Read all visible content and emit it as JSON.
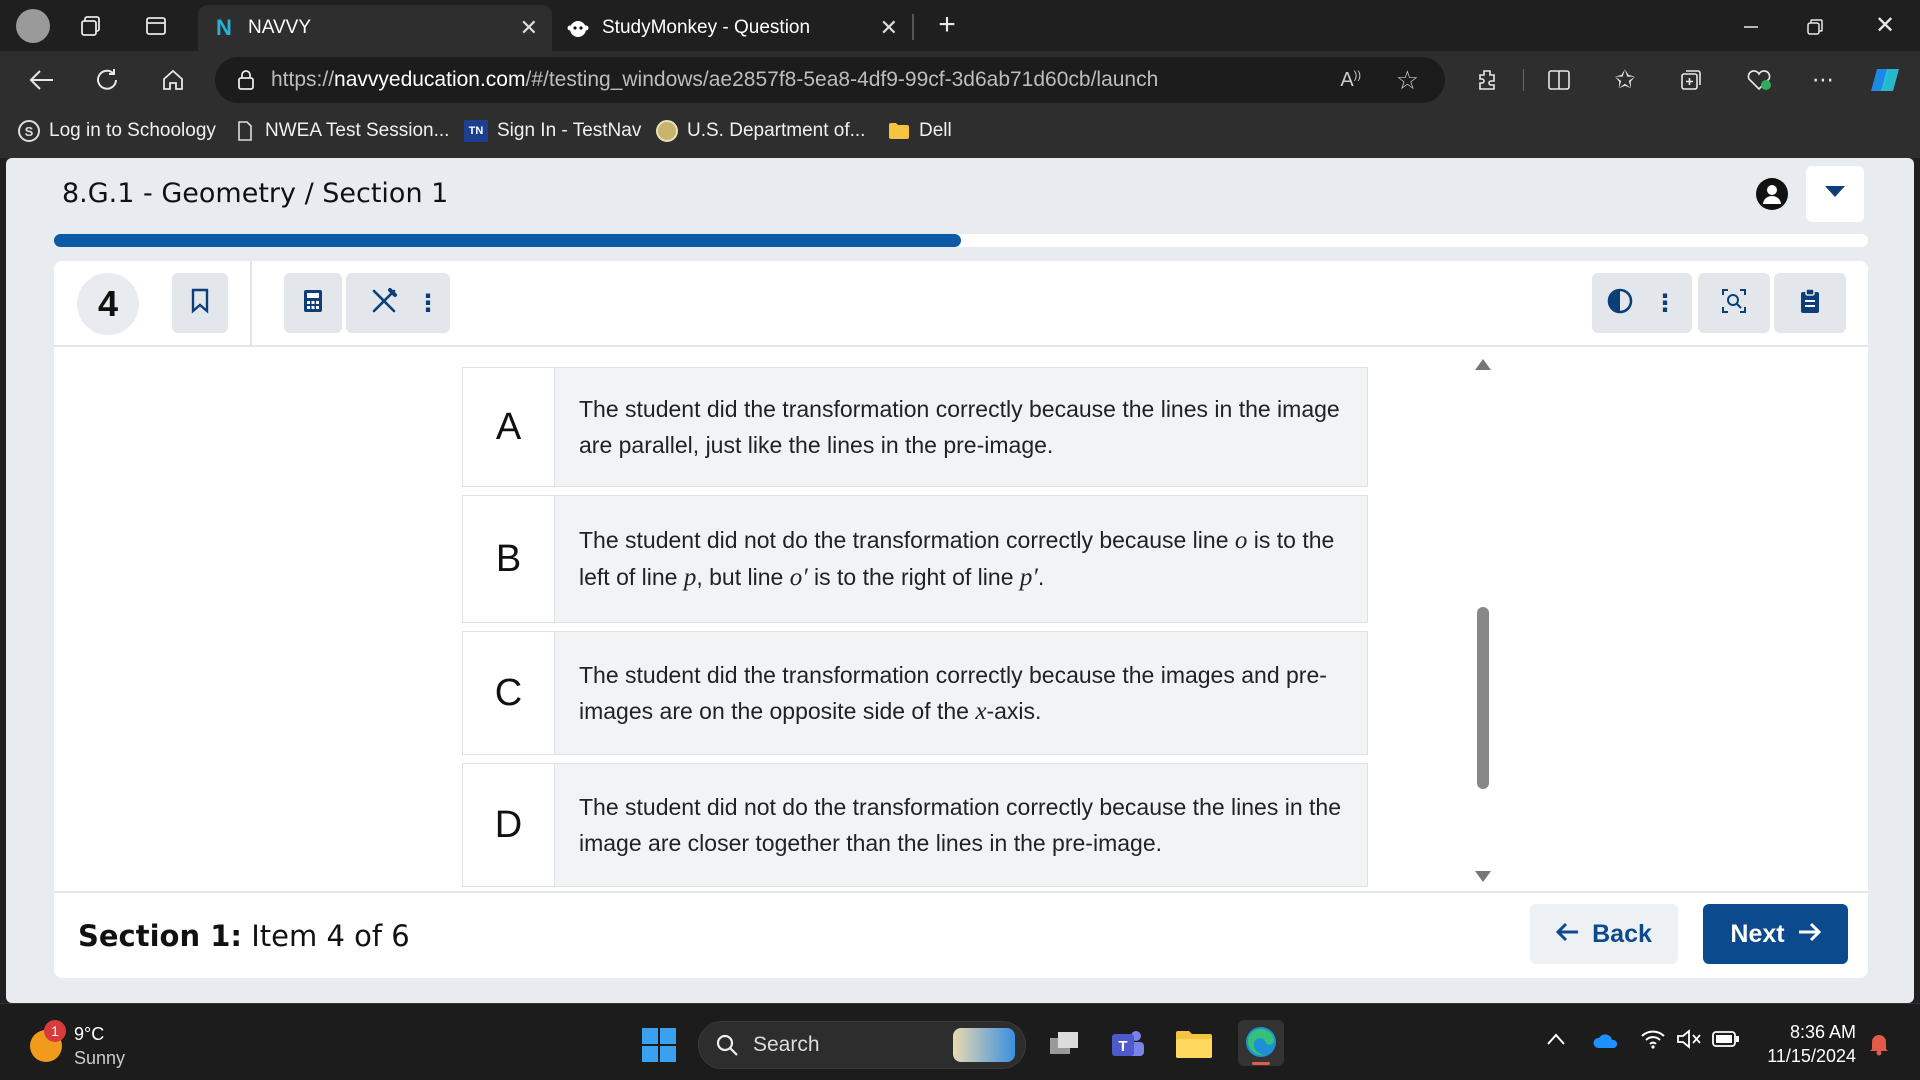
{
  "browser": {
    "tabs": [
      {
        "title": "NAVVY",
        "active": true
      },
      {
        "title": "StudyMonkey - Question",
        "active": false
      }
    ],
    "address": {
      "prefix": "https://",
      "host": "navvyeducation.com",
      "path": "/#/testing_windows/ae2857f8-5ea8-4df9-99cf-3d6ab71d60cb/launch"
    },
    "bookmarks": [
      "Log in to Schoology",
      "NWEA Test Session...",
      "Sign In - TestNav",
      "U.S. Department of...",
      "Dell"
    ],
    "bookmark_badges": {
      "testnav": "TN",
      "schoology": "S"
    }
  },
  "app": {
    "title": "8.G.1 - Geometry / Section 1",
    "progress_fraction": 0.5,
    "question_number": "4",
    "choices": [
      {
        "letter": "A",
        "parts": [
          "The student did the transformation correctly because the lines in the image are parallel, just like the lines in the pre-image."
        ]
      },
      {
        "letter": "B",
        "parts": [
          "The student did not do the transformation correctly because line ",
          "o",
          " is to the left of line ",
          "p",
          ", but line ",
          "o′",
          " is to the right of line ",
          "p′",
          "."
        ]
      },
      {
        "letter": "C",
        "parts": [
          "The student did the transformation correctly because the images and pre-images are on the opposite side of the ",
          "x",
          "-axis."
        ]
      },
      {
        "letter": "D",
        "parts": [
          "The student did not do the transformation correctly because the lines in the image are closer together than the lines in the pre-image."
        ]
      }
    ],
    "footer": {
      "section_bold": "Section 1:",
      "section_rest": " Item 4 of 6",
      "back_label": "Back",
      "next_label": "Next"
    },
    "colors": {
      "accent": "#0c4a8e",
      "progress": "#0c5aa6"
    }
  },
  "taskbar": {
    "weather_temp": "9°C",
    "weather_desc": "Sunny",
    "notification_count": "1",
    "search_placeholder": "Search",
    "time": "8:36 AM",
    "date": "11/15/2024"
  }
}
